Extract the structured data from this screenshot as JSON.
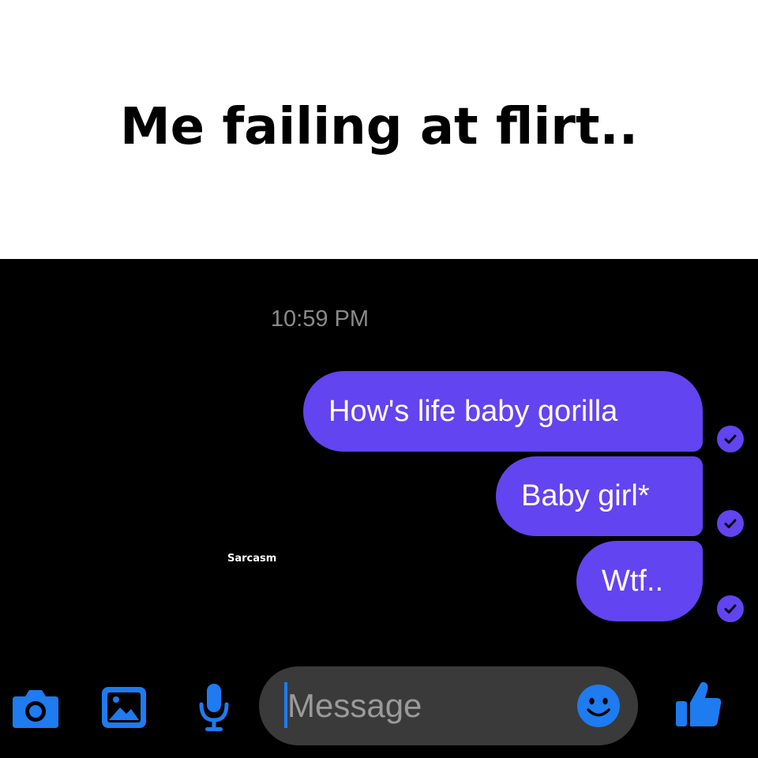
{
  "caption": "Me failing at flirt..",
  "conversation": {
    "timestamp": "10:59 PM",
    "messages": [
      {
        "text": "How's life baby gorilla",
        "status": "read"
      },
      {
        "text": "Baby girl*",
        "status": "read"
      },
      {
        "text": "Wtf..",
        "status": "read"
      }
    ]
  },
  "watermark": "Sarcasm",
  "composer": {
    "placeholder": "Message",
    "icons": [
      "camera-icon",
      "image-icon",
      "microphone-icon",
      "emoji-icon",
      "thumbs-up-icon"
    ]
  },
  "colors": {
    "bubble": "#6244f0",
    "accent": "#1e7bf0",
    "background": "#000000",
    "input": "#3a3a3a"
  }
}
